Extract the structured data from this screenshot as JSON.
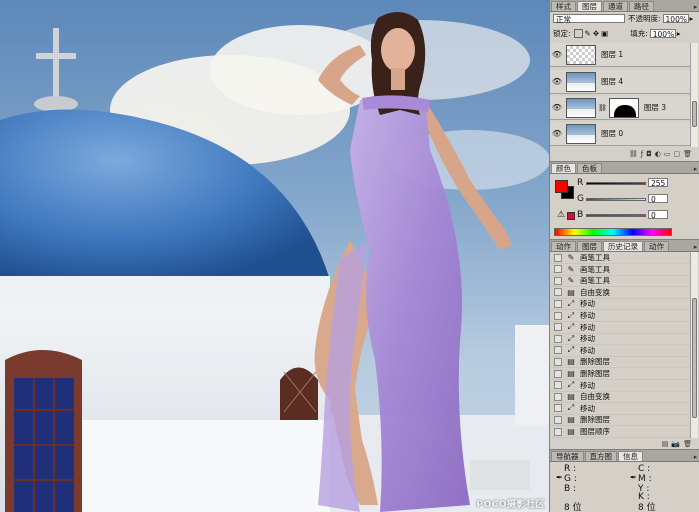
{
  "layers_panel": {
    "tabs": [
      "样式",
      "图层",
      "通道",
      "路径"
    ],
    "active_tab": 1,
    "blend_mode": "正常",
    "opacity_label": "不透明度:",
    "opacity_value": "100%",
    "lock_label": "锁定:",
    "fill_label": "填充:",
    "fill_value": "100%",
    "layers": [
      {
        "name": "图层 1",
        "thumb": "checker",
        "visible": true
      },
      {
        "name": "图层 4",
        "thumb": "photo",
        "visible": true
      },
      {
        "name": "图层 3",
        "thumb": "photo",
        "mask": true,
        "visible": true
      },
      {
        "name": "图层 0",
        "thumb": "photo",
        "visible": true
      }
    ]
  },
  "color_panel": {
    "tabs": [
      "颜色",
      "色板"
    ],
    "active_tab": 0,
    "r_label": "R",
    "g_label": "G",
    "b_label": "B",
    "r_value": "255",
    "g_value": "0",
    "b_value": "0",
    "foreground": "#ff0000",
    "background": "#000000"
  },
  "history_panel": {
    "tabs": [
      "动作",
      "图层",
      "历史记录",
      "动作"
    ],
    "active_tab": 2,
    "items": [
      {
        "icon": "brush",
        "label": "画笔工具"
      },
      {
        "icon": "brush",
        "label": "画笔工具"
      },
      {
        "icon": "brush",
        "label": "画笔工具"
      },
      {
        "icon": "doc",
        "label": "自由变换"
      },
      {
        "icon": "move",
        "label": "移动"
      },
      {
        "icon": "move",
        "label": "移动"
      },
      {
        "icon": "move",
        "label": "移动"
      },
      {
        "icon": "move",
        "label": "移动"
      },
      {
        "icon": "move",
        "label": "移动"
      },
      {
        "icon": "doc",
        "label": "删除图层"
      },
      {
        "icon": "doc",
        "label": "删除图层"
      },
      {
        "icon": "move",
        "label": "移动"
      },
      {
        "icon": "doc",
        "label": "自由变换"
      },
      {
        "icon": "move",
        "label": "移动"
      },
      {
        "icon": "doc",
        "label": "删除图层"
      },
      {
        "icon": "doc",
        "label": "图层顺序"
      }
    ]
  },
  "info_panel": {
    "tabs": [
      "导航器",
      "直方图",
      "信息"
    ],
    "active_tab": 2,
    "r_label": "R :",
    "g_label": "G :",
    "b_label": "B :",
    "c_label": "C :",
    "m_label": "M :",
    "y_label": "Y :",
    "k_label": "K :",
    "left_bits": "8 位",
    "right_bits": "8 位"
  },
  "watermark": "POCO摄影社区"
}
